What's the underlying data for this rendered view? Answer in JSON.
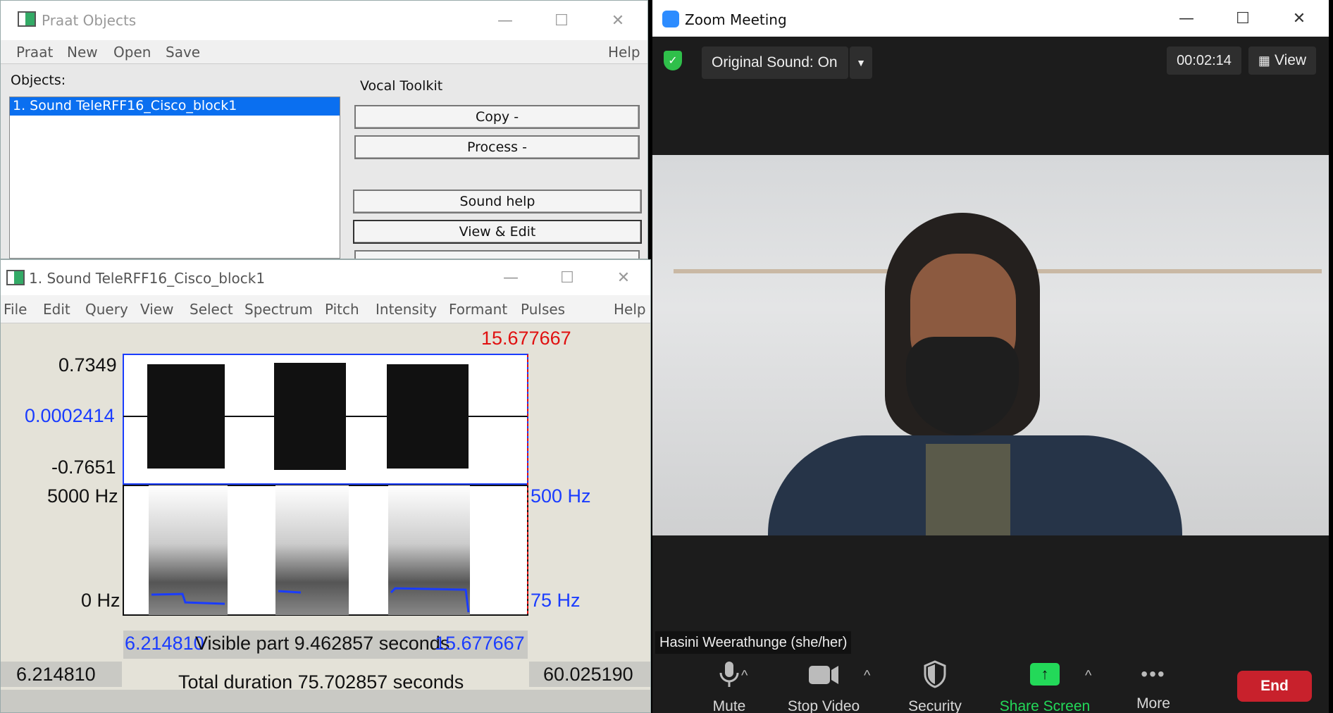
{
  "praat_objects": {
    "title": "Praat Objects",
    "menu": [
      "Praat",
      "New",
      "Open",
      "Save"
    ],
    "help": "Help",
    "objects_label": "Objects:",
    "list": [
      "1. Sound TeleRFF16_Cisco_block1"
    ],
    "toolkit_label": "Vocal Toolkit",
    "buttons": {
      "copy": "Copy -",
      "process": "Process -",
      "sound_help": "Sound help",
      "view_edit": "View & Edit"
    }
  },
  "sound_editor": {
    "title": "1. Sound TeleRFF16_Cisco_block1",
    "menu": [
      "File",
      "Edit",
      "Query",
      "View",
      "Select",
      "Spectrum",
      "Pitch",
      "Intensity",
      "Formant",
      "Pulses"
    ],
    "help": "Help",
    "cursor_time": "15.677667",
    "wave_max": "0.7349",
    "wave_mid": "0.0002414",
    "wave_min": "-0.7651",
    "spec_max": "5000 Hz",
    "spec_min": "0 Hz",
    "pitch_max": "500 Hz",
    "pitch_min": "75 Hz",
    "sel_start": "6.214810",
    "visible_part": "Visible part 9.462857 seconds",
    "sel_end": "15.677667",
    "left_time": "6.214810",
    "right_time": "60.025190",
    "total_duration": "Total duration 75.702857 seconds",
    "colors": {
      "accent_blue": "#1a3cff",
      "cursor_red": "#e01010"
    }
  },
  "zoom": {
    "title": "Zoom Meeting",
    "original_sound": "Original Sound: On",
    "timer": "00:02:14",
    "view": "View",
    "participant": "Hasini Weerathunge (she/her)",
    "toolbar": {
      "mute": "Mute",
      "stop_video": "Stop Video",
      "security": "Security",
      "share_screen": "Share Screen",
      "more": "More",
      "end": "End"
    },
    "colors": {
      "share_green": "#23d959",
      "end_red": "#c8212c",
      "shield_green": "#2fbf4a"
    }
  }
}
